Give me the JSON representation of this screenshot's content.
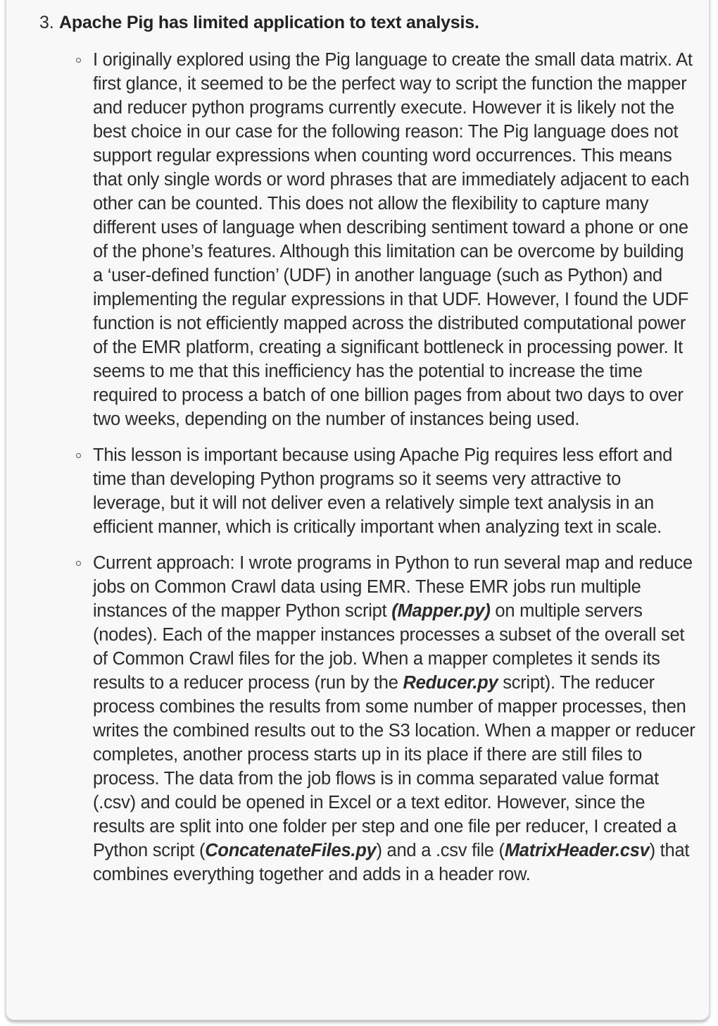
{
  "list": {
    "number": "3.",
    "title": "Apache Pig  has limited application to text analysis.",
    "bullets": {
      "b1": {
        "text": "I originally explored using the Pig language to create the small data matrix. At first glance, it seemed to be the perfect way to script the function the mapper and reducer python programs currently execute. However it is likely not the best choice in our case for the following reason: The Pig language does not support regular expressions when counting word occurrences. This means that only single words or word phrases that are immediately adjacent to each other can be counted. This does not allow the flexibility to capture many different uses of language when describing sentiment toward a phone or one of the phone’s features. Although this limitation can be overcome by building a ‘user-defined function’ (UDF) in another language (such as Python) and implementing the regular expressions in that UDF. However, I found the UDF function is not efficiently mapped across the distributed computational power of the EMR platform, creating a significant bottleneck in processing power. It seems to me that this inefficiency has the potential to increase the time required to process a batch of one billion pages from about two days to over two weeks, depending on the number of instances being used."
      },
      "b2": {
        "text": "This lesson is important because using Apache Pig requires less effort and time than developing Python programs so it seems very attractive to leverage, but it will not deliver even a relatively simple text analysis in an efficient manner, which is critically important when analyzing text in scale."
      },
      "b3": {
        "t1": "Current approach: I wrote programs in Python to run several map and reduce jobs on Common Crawl data using EMR. These EMR jobs run multiple instances of the mapper Python script ",
        "f1": "(Mapper.py)",
        "t2": " on multiple servers (nodes).  Each of the mapper instances processes a subset of the overall set of Common Crawl files for the job. When a mapper completes it sends its results to a reducer process (run by the ",
        "f2": "Reducer.py",
        "t3": " script). The reducer process combines the results from some number of mapper processes, then writes the combined results out to the S3 location. When a mapper or reducer completes, another process starts up in its place if there are still files to process. The data from the job flows is in comma separated value format (.csv) and could be opened in Excel or a text editor. However, since the results are split into one folder per step and one file per reducer, I created a Python script (",
        "f3": "ConcatenateFiles.py",
        "t4": ") and a .csv file (",
        "f4": "MatrixHeader.csv",
        "t5": ") that combines everything together and adds in a header row."
      }
    }
  }
}
